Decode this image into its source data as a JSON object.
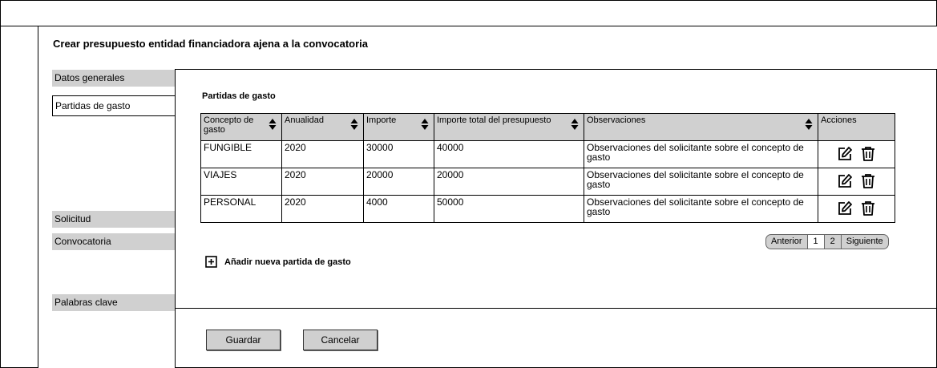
{
  "page_title": "Crear presupuesto entidad financiadora ajena a la convocatoria",
  "sidebar": {
    "items": [
      {
        "label": "Datos generales"
      },
      {
        "label": "Partidas de gasto"
      },
      {
        "label": "Solicitud"
      },
      {
        "label": "Convocatoria"
      },
      {
        "label": "Palabras clave"
      }
    ],
    "active_index": 1
  },
  "section_title": "Partidas de gasto",
  "table": {
    "columns": [
      {
        "label": "Concepto de gasto",
        "sortable": true
      },
      {
        "label": "Anualidad",
        "sortable": true
      },
      {
        "label": "Importe",
        "sortable": true
      },
      {
        "label": "Importe total del presupuesto",
        "sortable": true
      },
      {
        "label": "Observaciones",
        "sortable": true
      },
      {
        "label": "Acciones",
        "sortable": false
      }
    ],
    "rows": [
      {
        "concepto": "FUNGIBLE",
        "anualidad": "2020",
        "importe": "30000",
        "total": "40000",
        "observaciones": "Observaciones del solicitante sobre el concepto de gasto"
      },
      {
        "concepto": "VIAJES",
        "anualidad": "2020",
        "importe": "20000",
        "total": "20000",
        "observaciones": "Observaciones del solicitante sobre el concepto de gasto"
      },
      {
        "concepto": "PERSONAL",
        "anualidad": "2020",
        "importe": "4000",
        "total": "50000",
        "observaciones": "Observaciones del solicitante sobre el concepto de gasto"
      }
    ],
    "action_icons": [
      "edit-icon",
      "trash-icon"
    ]
  },
  "pagination": {
    "prev_label": "Anterior",
    "pages": [
      "1",
      "2"
    ],
    "next_label": "Siguiente"
  },
  "add_item": {
    "label": "Añadir nueva partida de gasto",
    "icon": "plus-square-icon"
  },
  "buttons": {
    "save_label": "Guardar",
    "cancel_label": "Cancelar"
  },
  "colors": {
    "gray": "#d0d0d0",
    "border": "#000000"
  }
}
